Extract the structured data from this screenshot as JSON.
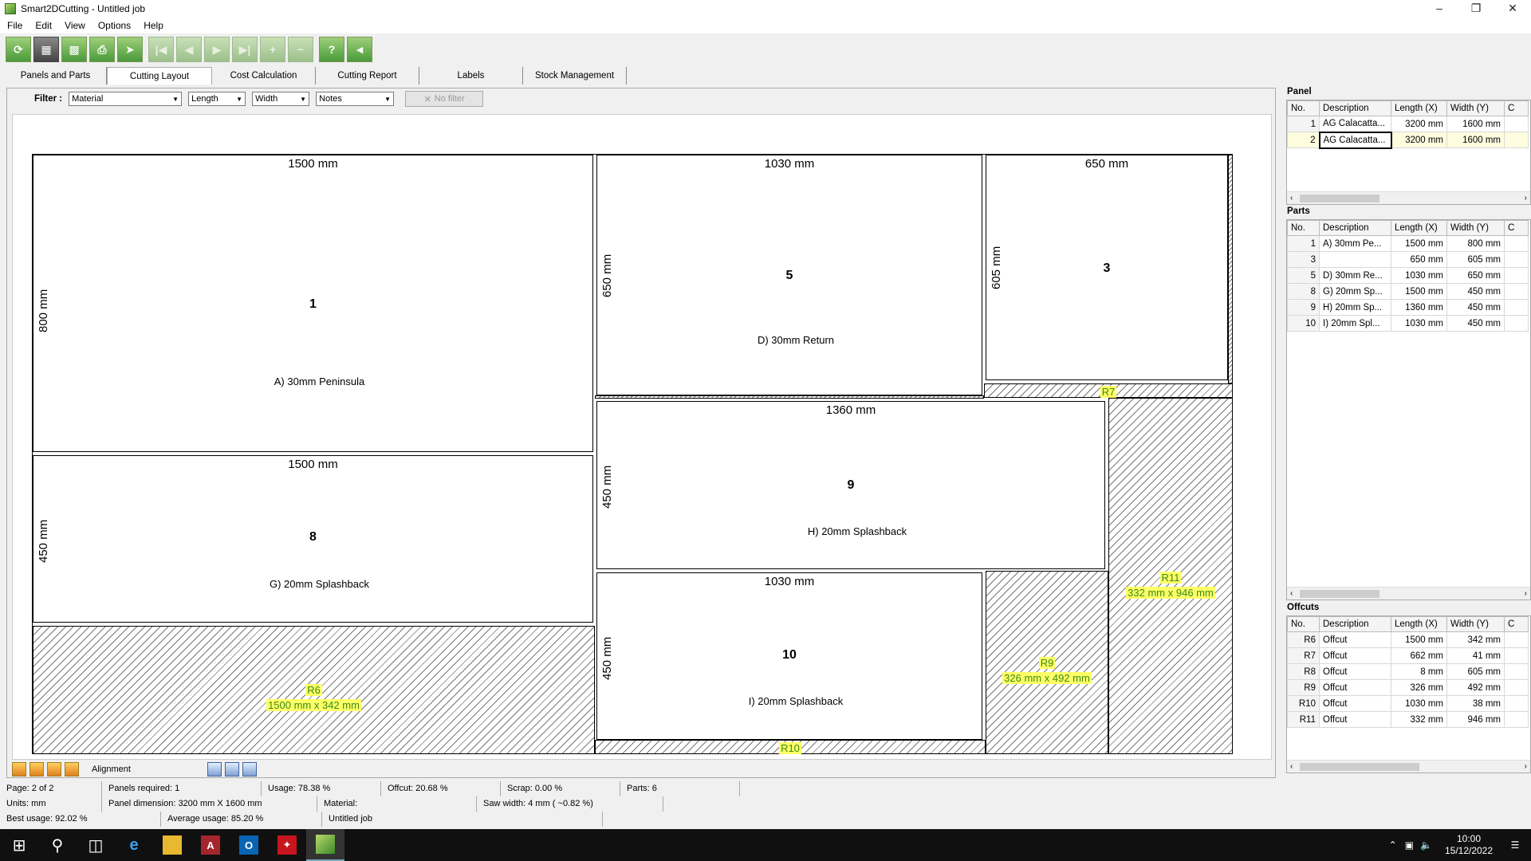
{
  "window": {
    "title": "Smart2DCutting - Untitled job"
  },
  "menu": [
    "File",
    "Edit",
    "View",
    "Options",
    "Help"
  ],
  "tabs": [
    "Panels and Parts",
    "Cutting Layout",
    "Cost Calculation",
    "Cutting Report",
    "Labels",
    "Stock Management"
  ],
  "filter": {
    "label": "Filter :",
    "material": "Material",
    "length": "Length",
    "width": "Width",
    "notes": "Notes",
    "no_filter": "No filter"
  },
  "layout": {
    "parts": [
      {
        "num": "1",
        "length": "1500 mm",
        "width": "800 mm",
        "desc": "A) 30mm Peninsula"
      },
      {
        "num": "5",
        "length": "1030 mm",
        "width": "650 mm",
        "desc": "D) 30mm Return"
      },
      {
        "num": "3",
        "length": "650 mm",
        "width": "605 mm",
        "desc": ""
      },
      {
        "num": "9",
        "length": "1360 mm",
        "width": "450 mm",
        "desc": "H) 20mm Splashback"
      },
      {
        "num": "8",
        "length": "1500 mm",
        "width": "450 mm",
        "desc": "G) 20mm Splashback"
      },
      {
        "num": "10",
        "length": "1030 mm",
        "width": "450 mm",
        "desc": "I) 20mm Splashback"
      }
    ],
    "offcuts": [
      {
        "id": "R6",
        "dims": "1500 mm x 342 mm"
      },
      {
        "id": "R7",
        "dims": ""
      },
      {
        "id": "R9",
        "dims": "326 mm x 492 mm"
      },
      {
        "id": "R10",
        "dims": ""
      },
      {
        "id": "R11",
        "dims": "332 mm x 946 mm"
      }
    ]
  },
  "bottom_tools": {
    "alignment": "Alignment"
  },
  "panel_grid": {
    "title": "Panel",
    "headers": [
      "No.",
      "Description",
      "Length (X)",
      "Width (Y)",
      "C"
    ],
    "rows": [
      {
        "no": "1",
        "desc": "AG Calacatta...",
        "len": "3200 mm",
        "wid": "1600 mm"
      },
      {
        "no": "2",
        "desc": "AG Calacatta...",
        "len": "3200 mm",
        "wid": "1600 mm"
      }
    ]
  },
  "parts_grid": {
    "title": "Parts",
    "headers": [
      "No.",
      "Description",
      "Length (X)",
      "Width (Y)",
      "C"
    ],
    "rows": [
      {
        "no": "1",
        "desc": "A) 30mm Pe...",
        "len": "1500 mm",
        "wid": "800 mm"
      },
      {
        "no": "3",
        "desc": "",
        "len": "650 mm",
        "wid": "605 mm"
      },
      {
        "no": "5",
        "desc": "D) 30mm Re...",
        "len": "1030 mm",
        "wid": "650 mm"
      },
      {
        "no": "8",
        "desc": "G) 20mm Sp...",
        "len": "1500 mm",
        "wid": "450 mm"
      },
      {
        "no": "9",
        "desc": "H) 20mm Sp...",
        "len": "1360 mm",
        "wid": "450 mm"
      },
      {
        "no": "10",
        "desc": "I) 20mm Spl...",
        "len": "1030 mm",
        "wid": "450 mm"
      }
    ]
  },
  "offcuts_grid": {
    "title": "Offcuts",
    "headers": [
      "No.",
      "Description",
      "Length (X)",
      "Width (Y)",
      "C"
    ],
    "rows": [
      {
        "no": "R6",
        "desc": "Offcut",
        "len": "1500 mm",
        "wid": "342 mm"
      },
      {
        "no": "R7",
        "desc": "Offcut",
        "len": "662 mm",
        "wid": "41 mm"
      },
      {
        "no": "R8",
        "desc": "Offcut",
        "len": "8 mm",
        "wid": "605 mm"
      },
      {
        "no": "R9",
        "desc": "Offcut",
        "len": "326 mm",
        "wid": "492 mm"
      },
      {
        "no": "R10",
        "desc": "Offcut",
        "len": "1030 mm",
        "wid": "38 mm"
      },
      {
        "no": "R11",
        "desc": "Offcut",
        "len": "332 mm",
        "wid": "946 mm"
      }
    ]
  },
  "status": {
    "row1": [
      "Page: 2 of 2",
      "Panels required: 1",
      "Usage: 78.38 %",
      "Offcut: 20.68 %",
      "Scrap: 0.00 %",
      "Parts: 6"
    ],
    "row2": [
      "Units: mm",
      "Panel dimension: 3200 mm X 1600 mm",
      "Material:",
      "Saw width: 4 mm   ( ~0.82 %)"
    ],
    "row3": [
      "Best usage: 92.02 %",
      "Average usage: 85.20 %",
      "Untitled job"
    ]
  },
  "taskbar": {
    "time": "10:00",
    "date": "15/12/2022"
  }
}
